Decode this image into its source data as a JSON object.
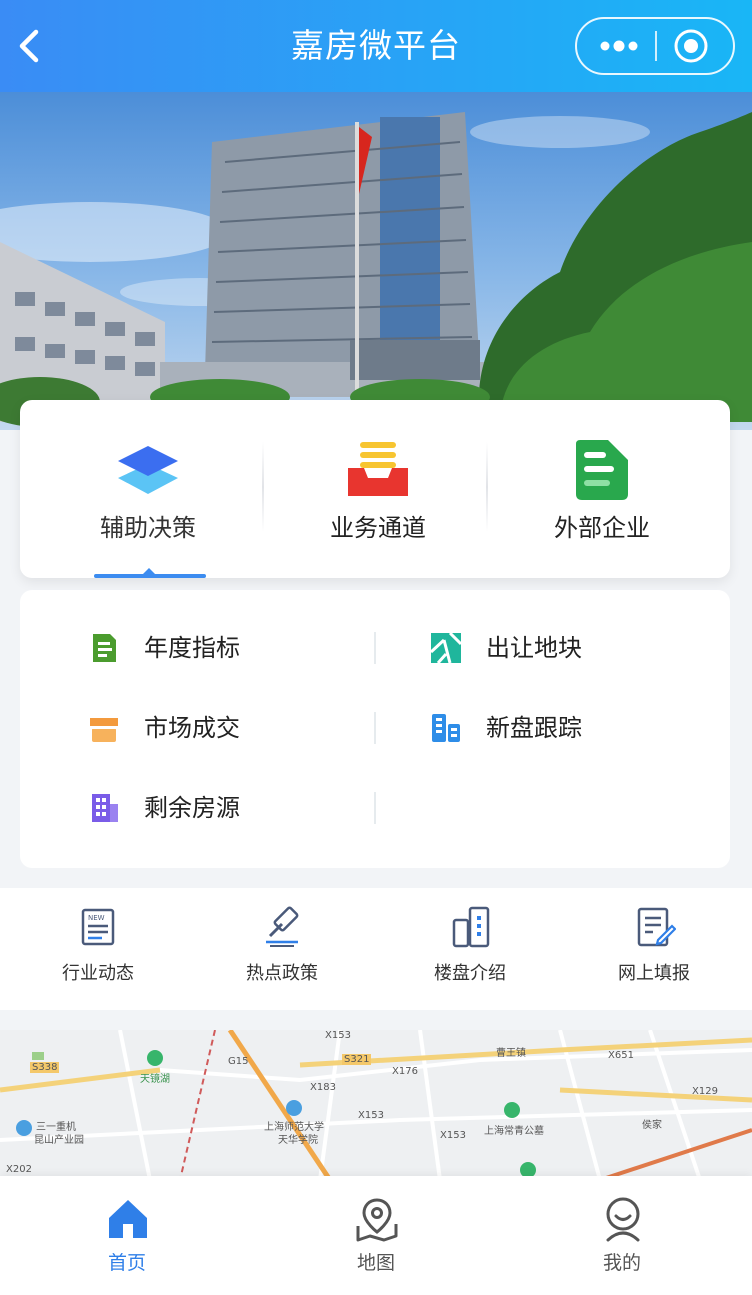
{
  "header": {
    "title": "嘉房微平台",
    "back_icon": "chevron-left-icon",
    "more_icon": "more-dots-icon",
    "close_icon": "target-circle-icon"
  },
  "banner": {
    "image": "government-building-photo"
  },
  "categories": [
    {
      "label": "辅助决策",
      "icon": "layers-icon",
      "active": true
    },
    {
      "label": "业务通道",
      "icon": "inbox-tray-icon",
      "active": false
    },
    {
      "label": "外部企业",
      "icon": "document-folder-icon",
      "active": false
    }
  ],
  "list_items": [
    {
      "label": "年度指标",
      "icon": "annual-index-icon"
    },
    {
      "label": "出让地块",
      "icon": "land-parcel-icon"
    },
    {
      "label": "市场成交",
      "icon": "market-deal-icon"
    },
    {
      "label": "新盘跟踪",
      "icon": "buildings-icon"
    },
    {
      "label": "剩余房源",
      "icon": "apartment-icon"
    }
  ],
  "shortcuts": [
    {
      "label": "行业动态",
      "icon": "news-icon"
    },
    {
      "label": "热点政策",
      "icon": "gavel-icon"
    },
    {
      "label": "楼盘介绍",
      "icon": "tower-icon"
    },
    {
      "label": "网上填报",
      "icon": "form-edit-icon"
    }
  ],
  "map": {
    "labels": [
      "X153",
      "S321",
      "X153",
      "曹王镇",
      "X651",
      "G15",
      "天镜湖",
      "X183",
      "X176",
      "X129",
      "三一重机",
      "昆山产业园",
      "上海师范大学",
      "天华学院",
      "X153",
      "上海常青公墓",
      "侯家",
      "X202",
      "S338"
    ]
  },
  "tabs": [
    {
      "label": "首页",
      "icon": "home-icon",
      "active": true
    },
    {
      "label": "地图",
      "icon": "map-pin-icon",
      "active": false
    },
    {
      "label": "我的",
      "icon": "user-icon",
      "active": false
    }
  ],
  "colors": {
    "accent": "#2f7fe8",
    "header_start": "#3a8cf5",
    "header_end": "#19b6f6"
  }
}
